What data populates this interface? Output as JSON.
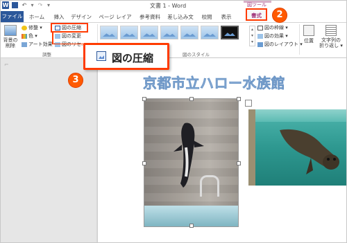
{
  "window": {
    "title": "文書 1 - Word",
    "context_group": "図ツール"
  },
  "tabs": [
    {
      "label": "ファイル"
    },
    {
      "label": "ホーム"
    },
    {
      "label": "挿入"
    },
    {
      "label": "デザイン"
    },
    {
      "label": "ページ レイアウト"
    },
    {
      "label": "参考資料"
    },
    {
      "label": "差し込み文書"
    },
    {
      "label": "校閲"
    },
    {
      "label": "表示"
    },
    {
      "label": "書式"
    }
  ],
  "ribbon": {
    "remove_background": "背景の\n削除",
    "corrections": "修整 ▾",
    "color": "色 ▾",
    "artistic_effects": "アート効果 ▾",
    "compress_pictures": "図の圧縮",
    "change_picture": "図の変更",
    "reset_picture": "図のリセ…",
    "adjust_group_label": "調整",
    "styles_group_label": "図のスタイル",
    "picture_border": "図の枠線 ▾",
    "picture_effects": "図の効果 ▾",
    "picture_layout": "図のレイアウト ▾",
    "position": "位置",
    "wrap_text": "文字列の\n折り返し ▾"
  },
  "callout": {
    "label": "図の圧縮"
  },
  "badges": {
    "step_format": "2",
    "step_compress": "3"
  },
  "document": {
    "heading": "京都市立ハロー水族館"
  },
  "colors": {
    "accent": "#ff3b00",
    "word_blue": "#2b579a",
    "context_tab": "#a0357b"
  }
}
